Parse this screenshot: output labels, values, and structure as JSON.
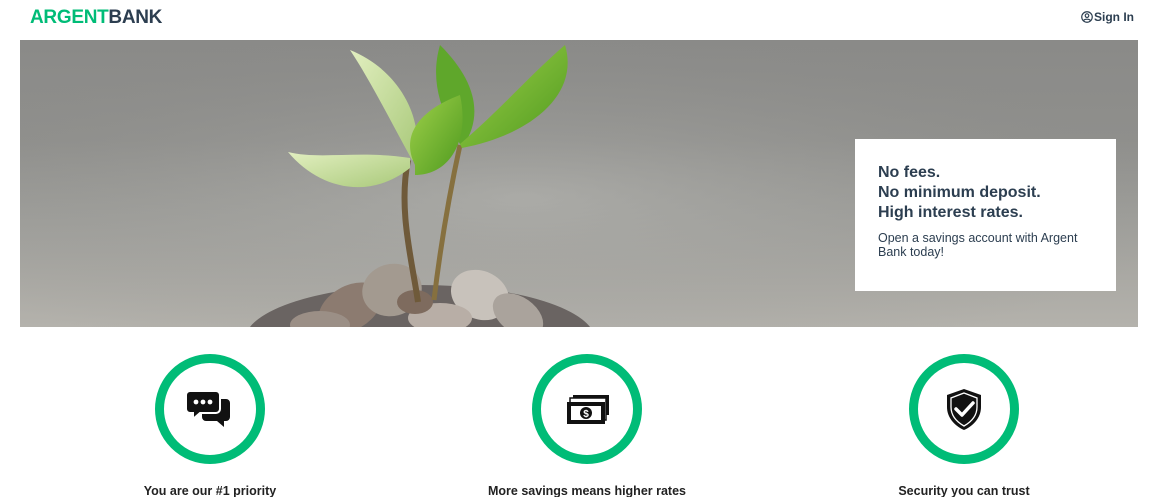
{
  "header": {
    "logo_part1": "ARGENT",
    "logo_part2": "BANK",
    "signin_label": "Sign In",
    "signin_icon": "user-circle-icon"
  },
  "hero": {
    "image_subject": "plant-sprout-growing-from-coins",
    "promo": {
      "lines": [
        "No fees.",
        "No minimum deposit.",
        "High interest rates."
      ],
      "text": "Open a savings account with Argent Bank today!"
    }
  },
  "features": [
    {
      "icon": "chat-bubbles-icon",
      "title": "You are our #1 priority"
    },
    {
      "icon": "money-bill-icon",
      "title": "More savings means higher rates"
    },
    {
      "icon": "shield-check-icon",
      "title": "Security you can trust"
    }
  ],
  "colors": {
    "brand_green": "#00bc77",
    "text_dark": "#2c3e50"
  }
}
